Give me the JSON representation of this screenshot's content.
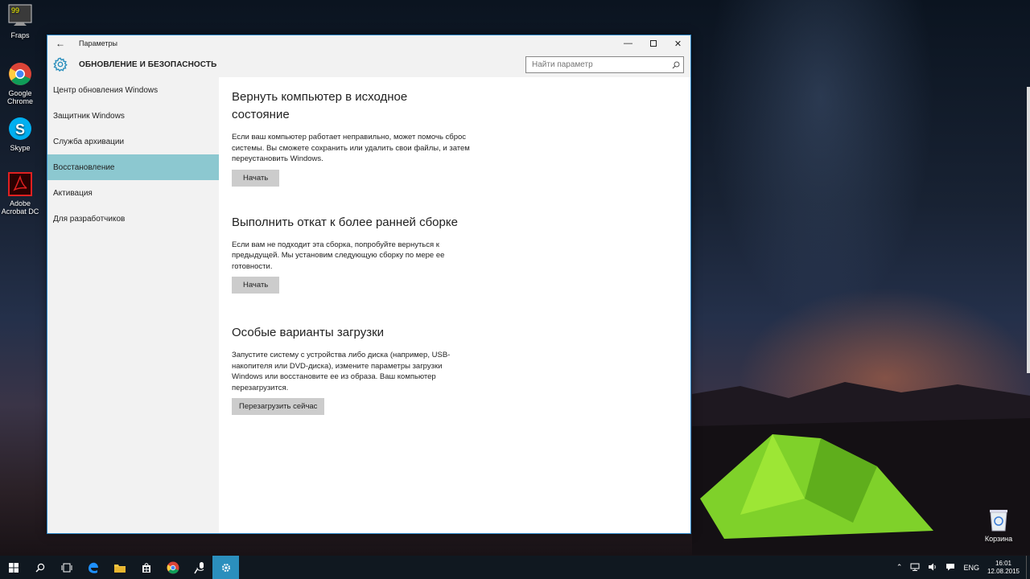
{
  "desktop": {
    "icons": [
      {
        "label": "Fraps",
        "icon": "fraps-icon"
      },
      {
        "label": "Google Chrome",
        "icon": "chrome-icon"
      },
      {
        "label": "Skype",
        "icon": "skype-icon"
      },
      {
        "label": "Adobe Acrobat DC",
        "icon": "acrobat-icon"
      }
    ],
    "fraps_counter": "99",
    "recycle_bin": "Корзина"
  },
  "window": {
    "title": "Параметры",
    "section_title": "ОБНОВЛЕНИЕ И БЕЗОПАСНОСТЬ",
    "search": {
      "placeholder": "Найти параметр"
    },
    "accent": "#8cc8d0"
  },
  "sidebar": {
    "items": [
      {
        "label": "Центр обновления Windows",
        "active": false
      },
      {
        "label": "Защитник Windows",
        "active": false
      },
      {
        "label": "Служба архивации",
        "active": false
      },
      {
        "label": "Восстановление",
        "active": true
      },
      {
        "label": "Активация",
        "active": false
      },
      {
        "label": "Для разработчиков",
        "active": false
      }
    ]
  },
  "content": {
    "reset": {
      "title": "Вернуть компьютер в исходное состояние",
      "description": "Если ваш компьютер работает неправильно, может помочь сброс системы. Вы сможете сохранить или удалить свои файлы, и затем переустановить Windows.",
      "button": "Начать"
    },
    "rollback": {
      "title": "Выполнить откат к более ранней сборке",
      "description": "Если вам не подходит эта сборка, попробуйте вернуться к предыдущей. Мы установим следующую сборку по мере ее готовности.",
      "button": "Начать"
    },
    "advanced": {
      "title": "Особые варианты загрузки",
      "description": "Запустите систему с устройства либо диска (например, USB-накопителя или DVD-диска), измените параметры загрузки Windows или восстановите ее из образа. Ваш компьютер перезагрузится.",
      "button": "Перезагрузить сейчас"
    }
  },
  "taskbar": {
    "language": "ENG",
    "time": "16:01",
    "date": "12.08.2015"
  }
}
